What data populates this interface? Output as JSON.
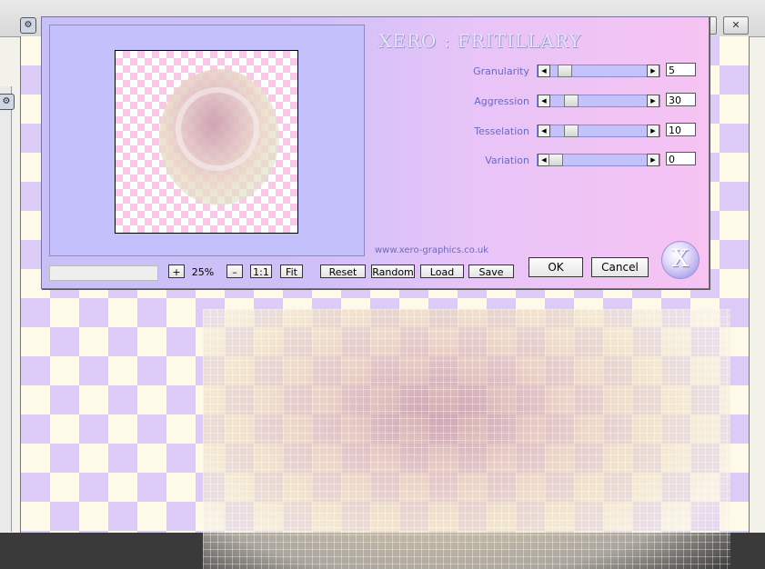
{
  "host": {
    "window_buttons": [
      "",
      "",
      "✕"
    ],
    "doc_icon": "⚙",
    "side_icon": "⚙"
  },
  "dialog": {
    "title": "XERO : FRITILLARY",
    "params": [
      {
        "label": "Granularity",
        "value": "5",
        "level": 0.1
      },
      {
        "label": "Aggression",
        "value": "30",
        "level": 0.18
      },
      {
        "label": "Tesselation",
        "value": "10",
        "level": 0.18
      },
      {
        "label": "Variation",
        "value": "0",
        "level": 0.0
      }
    ],
    "slider_left_arrow": "◀",
    "slider_right_arrow": "▶",
    "url": "www.xero-graphics.co.uk",
    "zoom": {
      "plus": "+",
      "value": "25%",
      "minus": "–",
      "one_to_one": "1:1",
      "fit": "Fit"
    },
    "buttons": {
      "reset": "Reset",
      "random": "Random",
      "load": "Load",
      "save": "Save",
      "ok": "OK",
      "cancel": "Cancel"
    },
    "logo_letter": "X"
  },
  "colors": {
    "label": "#6c68c2",
    "preview_bg": "#c3c0fb",
    "checker_pink": "#f7c9e6",
    "host_checker": "#dccbf7"
  }
}
